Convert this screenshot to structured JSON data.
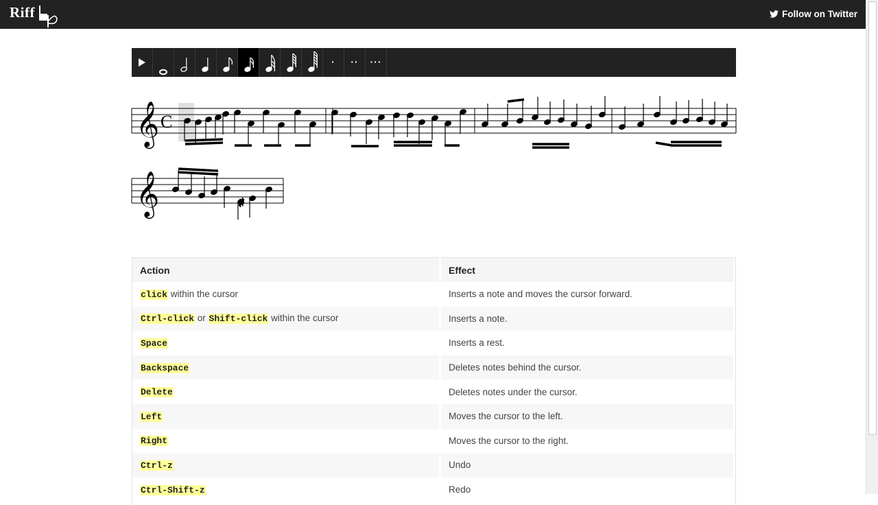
{
  "brand": {
    "name": "Riff"
  },
  "header": {
    "twitter_label": "Follow on Twitter"
  },
  "toolbar": {
    "buttons": [
      {
        "icon": "play-icon"
      },
      {
        "icon": "whole-note-icon"
      },
      {
        "icon": "half-note-icon"
      },
      {
        "icon": "quarter-note-icon"
      },
      {
        "icon": "eighth-note-icon"
      },
      {
        "icon": "sixteenth-note-icon",
        "active": true
      },
      {
        "icon": "thirty-second-note-icon"
      },
      {
        "icon": "sixty-fourth-note-icon"
      },
      {
        "icon": "hundred-twenty-eighth-note-icon"
      },
      {
        "icon": "dot-icon",
        "label": "·"
      },
      {
        "icon": "double-dot-icon",
        "label": "··"
      },
      {
        "icon": "triple-dot-icon",
        "label": "···"
      }
    ]
  },
  "table": {
    "headers": [
      "Action",
      "Effect"
    ],
    "rows": [
      {
        "keys": [
          "click"
        ],
        "between": [],
        "suffix": " within the cursor",
        "effect": "Inserts a note and moves the cursor forward."
      },
      {
        "keys": [
          "Ctrl-click",
          "Shift-click"
        ],
        "between": [
          " or "
        ],
        "suffix": " within the cursor",
        "effect": "Inserts a note."
      },
      {
        "keys": [
          "Space"
        ],
        "between": [],
        "suffix": "",
        "effect": "Inserts a rest."
      },
      {
        "keys": [
          "Backspace"
        ],
        "between": [],
        "suffix": "",
        "effect": "Deletes notes behind the cursor."
      },
      {
        "keys": [
          "Delete"
        ],
        "between": [],
        "suffix": "",
        "effect": "Deletes notes under the cursor."
      },
      {
        "keys": [
          "Left"
        ],
        "between": [],
        "suffix": "",
        "effect": "Moves the cursor to the left."
      },
      {
        "keys": [
          "Right"
        ],
        "between": [],
        "suffix": "",
        "effect": "Moves the cursor to the right."
      },
      {
        "keys": [
          "Ctrl-z"
        ],
        "between": [],
        "suffix": "",
        "effect": "Undo"
      },
      {
        "keys": [
          "Ctrl-Shift-z"
        ],
        "between": [],
        "suffix": "",
        "effect": "Redo"
      }
    ]
  },
  "score": {
    "time_signature": "C",
    "clef": "treble-clef"
  },
  "colors": {
    "topbar": "#222222",
    "highlight": "#ffff99"
  }
}
